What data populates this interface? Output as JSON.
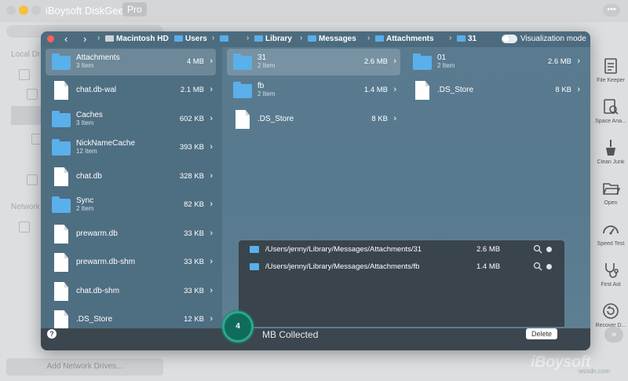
{
  "app": {
    "title": "iBoysoft DiskGeeker",
    "badge": "Pro",
    "more": "•••",
    "sidebar_labels": [
      "Local Drive",
      "Network"
    ],
    "add_network_label": "Add Network Drives..."
  },
  "tools": [
    {
      "label": "File Keeper",
      "icon": "file-keeper-icon"
    },
    {
      "label": "Space Ana...",
      "icon": "space-analyzer-icon"
    },
    {
      "label": "Clean Junk",
      "icon": "clean-junk-icon"
    },
    {
      "label": "Open",
      "icon": "folder-open-icon"
    },
    {
      "label": "Speed Test",
      "icon": "speed-test-icon"
    },
    {
      "label": "First Aid",
      "icon": "stethoscope-icon"
    },
    {
      "label": "Recover D...",
      "icon": "recover-data-icon"
    }
  ],
  "expand_label": "»",
  "brand": {
    "logo": "iBoysoft",
    "url": "wsxdn.com"
  },
  "toolbar": {
    "back": "‹",
    "forward": "›",
    "breadcrumb": [
      "Macintosh HD",
      "Users",
      "Library",
      "Messages",
      "Attachments",
      "31"
    ],
    "separator": "›",
    "visualization_label": "Visualization mode"
  },
  "columns": {
    "col1": [
      {
        "name": "Attachments",
        "sub": "3 Item",
        "size": "4 MB",
        "type": "folder",
        "selected": true
      },
      {
        "name": "chat.db-wal",
        "sub": "",
        "size": "2.1 MB",
        "type": "file"
      },
      {
        "name": "Caches",
        "sub": "3 Item",
        "size": "602 KB",
        "type": "folder"
      },
      {
        "name": "NickNameCache",
        "sub": "12 Item",
        "size": "393 KB",
        "type": "folder"
      },
      {
        "name": "chat.db",
        "sub": "",
        "size": "328 KB",
        "type": "file"
      },
      {
        "name": "Sync",
        "sub": "2 Item",
        "size": "82 KB",
        "type": "folder"
      },
      {
        "name": "prewarm.db",
        "sub": "",
        "size": "33 KB",
        "type": "file"
      },
      {
        "name": "prewarm.db-shm",
        "sub": "",
        "size": "33 KB",
        "type": "file"
      },
      {
        "name": "chat.db-shm",
        "sub": "",
        "size": "33 KB",
        "type": "file"
      },
      {
        "name": ".DS_Store",
        "sub": "",
        "size": "12 KB",
        "type": "file"
      }
    ],
    "col2": [
      {
        "name": "31",
        "sub": "2 Item",
        "size": "2.6 MB",
        "type": "folder",
        "selected": true
      },
      {
        "name": "fb",
        "sub": "2 Item",
        "size": "1.4 MB",
        "type": "folder"
      },
      {
        "name": ".DS_Store",
        "sub": "",
        "size": "8 KB",
        "type": "file"
      }
    ],
    "col3": [
      {
        "name": "01",
        "sub": "2 Item",
        "size": "2.6 MB",
        "type": "folder"
      },
      {
        "name": ".DS_Store",
        "sub": "",
        "size": "8 KB",
        "type": "file"
      }
    ]
  },
  "collected": {
    "items": [
      {
        "path": "/Users/jenny/Library/Messages/Attachments/31",
        "size": "2.6 MB"
      },
      {
        "path": "/Users/jenny/Library/Messages/Attachments/fb",
        "size": "1.4 MB"
      }
    ],
    "count": "4",
    "label": "MB Collected",
    "delete_label": "Delete",
    "help": "?"
  }
}
